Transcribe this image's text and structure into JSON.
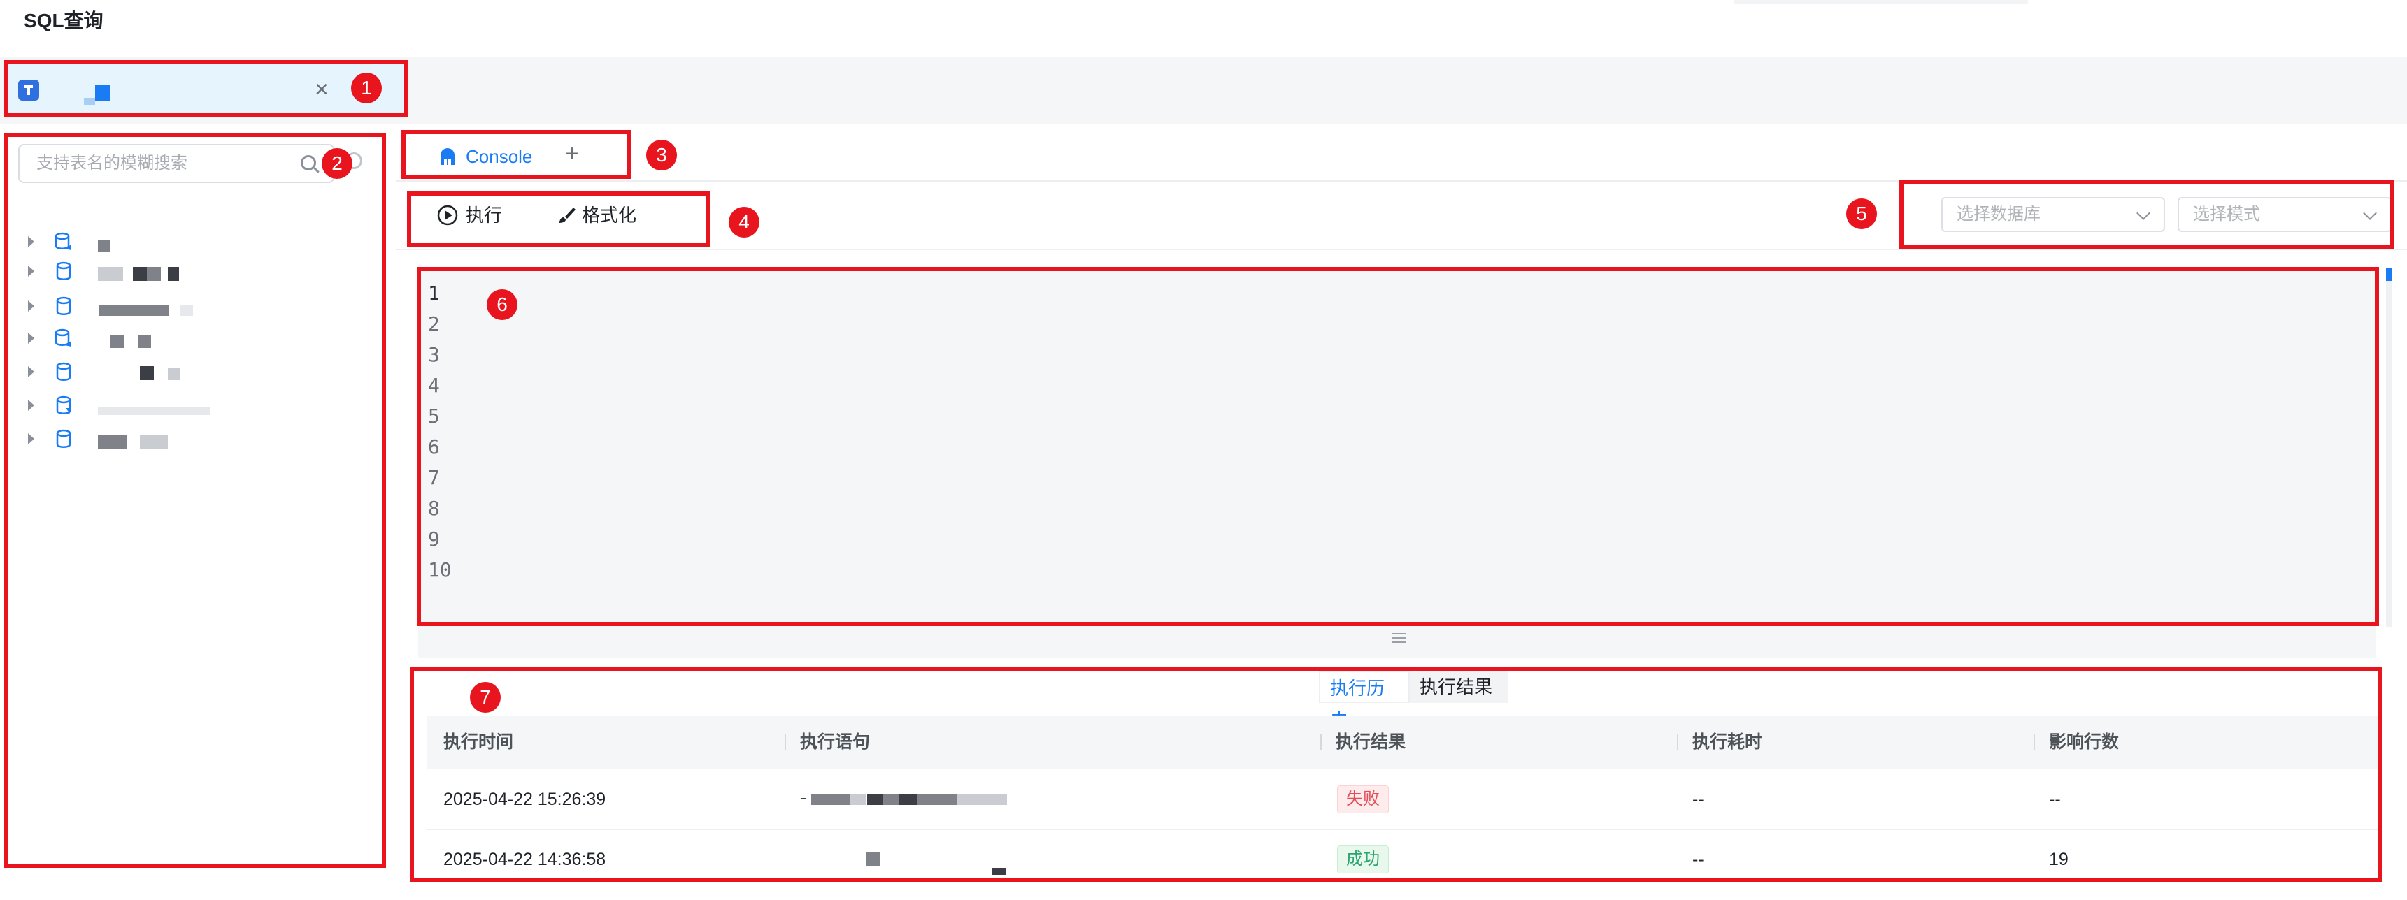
{
  "page": {
    "title": "SQL查询"
  },
  "connection_tab": {
    "name": "",
    "close_icon": "×"
  },
  "sidebar": {
    "search_placeholder": "支持表名的模糊搜索",
    "databases": [
      "",
      "",
      "",
      "",
      "",
      "",
      ""
    ]
  },
  "editor_tabs": {
    "tabs": [
      {
        "label": "Console"
      }
    ],
    "add_label": "+"
  },
  "toolbar": {
    "execute_label": "执行",
    "format_label": "格式化",
    "db_select_placeholder": "选择数据库",
    "schema_select_placeholder": "选择模式"
  },
  "editor": {
    "line_numbers": [
      "1",
      "2",
      "3",
      "4",
      "5",
      "6",
      "7",
      "8",
      "9",
      "10"
    ],
    "content": ""
  },
  "results": {
    "tabs": [
      "执行历史",
      "执行结果"
    ],
    "active_tab": "执行历史",
    "columns": [
      "执行时间",
      "执行语句",
      "执行结果",
      "执行耗时",
      "影响行数"
    ],
    "rows": [
      {
        "time": "2025-04-22 15:26:39",
        "statement": "",
        "result": "失败",
        "duration": "--",
        "affected": "--"
      },
      {
        "time": "2025-04-22 14:36:58",
        "statement": "",
        "result": "成功",
        "duration": "--",
        "affected": "19"
      }
    ]
  },
  "annotations": [
    "1",
    "2",
    "3",
    "4",
    "5",
    "6",
    "7"
  ],
  "colors": {
    "accent": "#1a7cf5",
    "annotation": "#e8141e",
    "fail_text": "#e34d59",
    "success_text": "#2ba471",
    "editor_bg": "#f5f6f8"
  }
}
